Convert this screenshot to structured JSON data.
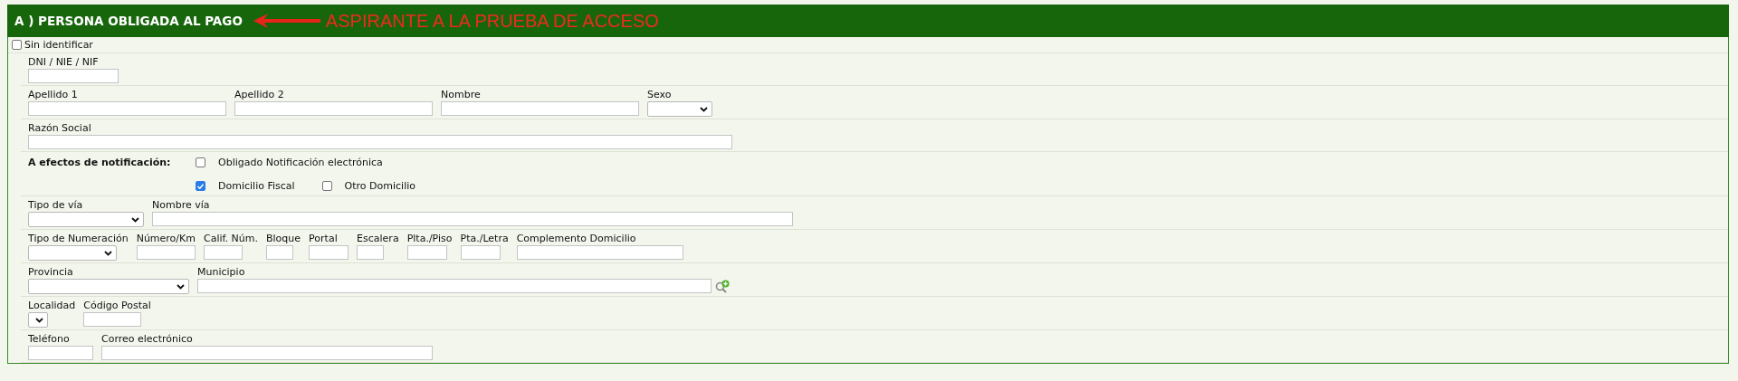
{
  "header": {
    "title": "A ) PERSONA OBLIGADA AL PAGO",
    "annotation": "ASPIRANTE A LA PRUEBA DE ACCESO"
  },
  "unidentified": {
    "label": "Sin identificar",
    "checked": false
  },
  "rows_top": [
    [
      {
        "label": "DNI / NIE / NIF",
        "kind": "text"
      }
    ],
    [
      {
        "label": "Apellido 1",
        "kind": "text"
      },
      {
        "label": "Apellido 2",
        "kind": "text"
      },
      {
        "label": "Nombre",
        "kind": "text"
      },
      {
        "label": "Sexo",
        "kind": "select"
      }
    ],
    [
      {
        "label": "Razón Social",
        "kind": "text"
      }
    ]
  ],
  "notification": {
    "label": "A efectos de notificación:",
    "options": [
      {
        "label": "Obligado Notificación electrónica",
        "checked": false
      },
      {
        "label": "Domicilio Fiscal",
        "checked": true
      },
      {
        "label": "Otro Domicilio",
        "checked": false
      }
    ]
  },
  "rows_bottom": [
    [
      {
        "label": "Tipo de vía",
        "kind": "select"
      },
      {
        "label": "Nombre vía",
        "kind": "text"
      }
    ],
    [
      {
        "label": "Tipo de Numeración",
        "kind": "select"
      },
      {
        "label": "Número/Km",
        "kind": "text"
      },
      {
        "label": "Calif. Núm.",
        "kind": "text"
      },
      {
        "label": "Bloque",
        "kind": "text"
      },
      {
        "label": "Portal",
        "kind": "text"
      },
      {
        "label": "Escalera",
        "kind": "text"
      },
      {
        "label": "Plta./Piso",
        "kind": "text"
      },
      {
        "label": "Pta./Letra",
        "kind": "text"
      },
      {
        "label": "Complemento Domicilio",
        "kind": "text"
      }
    ],
    [
      {
        "label": "Provincia",
        "kind": "select"
      },
      {
        "label": "Municipio",
        "kind": "lookup"
      }
    ],
    [
      {
        "label": "Localidad",
        "kind": "select"
      },
      {
        "label": "Código Postal",
        "kind": "text"
      }
    ],
    [
      {
        "label": "Teléfono",
        "kind": "text"
      },
      {
        "label": "Correo electrónico",
        "kind": "text"
      }
    ]
  ]
}
